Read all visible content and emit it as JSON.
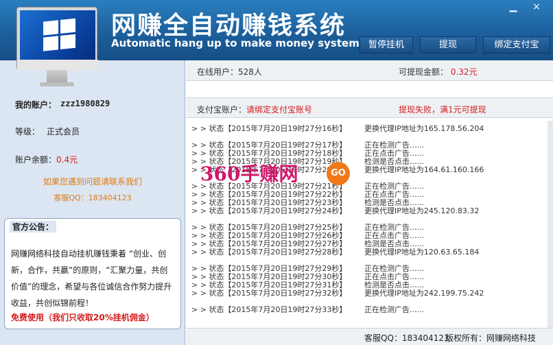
{
  "window": {
    "title": "网赚全自动赚钱系统",
    "subtitle": "Automatic hang up to make money system",
    "minimize": "▁",
    "close": "×"
  },
  "toolbar": {
    "pause_label": "暂停挂机",
    "withdraw_label": "提现",
    "bind_label": "绑定支付宝"
  },
  "account": {
    "label": "我的账户：",
    "value": "zzz1980829",
    "level_label": "等级：",
    "level_value": "正式会员",
    "balance_label": "账户余额：",
    "balance_value": "0.4元"
  },
  "contact": {
    "line1": "如果您遇到问题请联系我们",
    "line2": "客服QQ：183404123"
  },
  "notice": {
    "title": "官方公告：",
    "body": "网赚网络科技自动挂机赚钱秉着 “创业、创新，合作，共赢”的原则，“汇聚力量，共创价值”的理念，希望与各位诚信合作努力提升收益，共创似锦前程！",
    "free": "免费使用（我们只收取20%挂机佣金）"
  },
  "stats": {
    "online": "在线用户：528人",
    "withdrawable_label": "可提现金额：",
    "withdrawable_value": "0.32元"
  },
  "alipay": {
    "label": "支付宝账户：",
    "value": "请绑定支付宝账号",
    "error": "提现失败，满1元可提现"
  },
  "log": [
    {
      "status": "> > 状态【2015年7月20日19时27分16秒】",
      "msg": "更换代理IP地址为165.178.56.204"
    },
    {
      "status": "> > 状态【2015年7月20日19时27分17秒】",
      "msg": "正在检测广告......"
    },
    {
      "status": "> > 状态【2015年7月20日19时27分18秒】",
      "msg": "正在点击广告......"
    },
    {
      "status": "> > 状态【2015年7月20日19时27分19秒】",
      "msg": "检测是否点击......"
    },
    {
      "status": "> > 状态【2015年7月20日19时27分20秒】",
      "msg": "更换代理IP地址为164.61.160.166"
    },
    {
      "status": "> > 状态【2015年7月20日19时27分21秒】",
      "msg": "正在检测广告......"
    },
    {
      "status": "> > 状态【2015年7月20日19时27分22秒】",
      "msg": "正在点击广告......"
    },
    {
      "status": "> > 状态【2015年7月20日19时27分23秒】",
      "msg": "检测是否点击......"
    },
    {
      "status": "> > 状态【2015年7月20日19时27分24秒】",
      "msg": "更换代理IP地址为245.120.83.32"
    },
    {
      "status": "> > 状态【2015年7月20日19时27分25秒】",
      "msg": "正在检测广告......"
    },
    {
      "status": "> > 状态【2015年7月20日19时27分26秒】",
      "msg": "正在点击广告......"
    },
    {
      "status": "> > 状态【2015年7月20日19时27分27秒】",
      "msg": "检测是否点击......"
    },
    {
      "status": "> > 状态【2015年7月20日19时27分28秒】",
      "msg": "更换代理IP地址为120.63.65.184"
    },
    {
      "status": "> > 状态【2015年7月20日19时27分29秒】",
      "msg": "正在检测广告......"
    },
    {
      "status": "> > 状态【2015年7月20日19时27分30秒】",
      "msg": "正在点击广告......"
    },
    {
      "status": "> > 状态【2015年7月20日19时27分31秒】",
      "msg": "检测是否点击......"
    },
    {
      "status": "> > 状态【2015年7月20日19时27分32秒】",
      "msg": "更换代理IP地址为242.199.75.242"
    },
    {
      "status": "> > 状态【2015年7月20日19时27分33秒】",
      "msg": "正在检测广告......"
    }
  ],
  "watermark": {
    "text": "360手赚网",
    "badge": "GO"
  },
  "footer": {
    "qq": "客服QQ：183404123",
    "copyright": "版权所有：网赚网络科技"
  },
  "icons": {
    "logo": "windows-monitor-icon",
    "apple": ""
  },
  "colors": {
    "header": "#1c5f9c",
    "accent_red": "#d41c1c",
    "accent_orange": "#e07a10",
    "panel": "#dbe6f2"
  }
}
